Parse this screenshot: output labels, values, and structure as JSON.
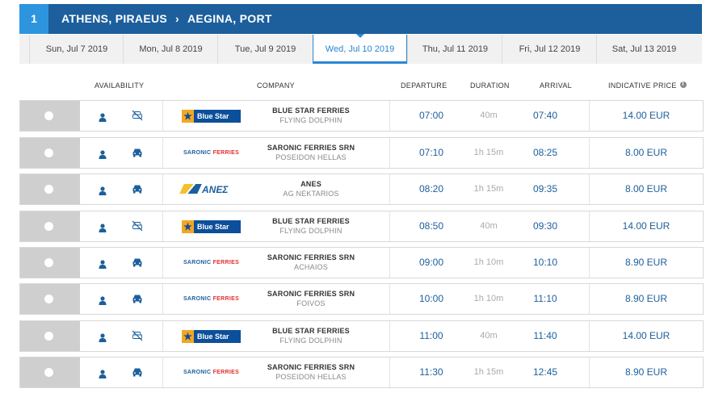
{
  "route": {
    "number": "1",
    "origin": "ATHENS, PIRAEUS",
    "arrow": "›",
    "destination": "AEGINA, PORT"
  },
  "date_tabs": [
    {
      "label": "Sun, Jul 7 2019",
      "active": false
    },
    {
      "label": "Mon, Jul 8 2019",
      "active": false
    },
    {
      "label": "Tue, Jul 9 2019",
      "active": false
    },
    {
      "label": "Wed, Jul 10 2019",
      "active": true
    },
    {
      "label": "Thu, Jul 11 2019",
      "active": false
    },
    {
      "label": "Fri, Jul 12 2019",
      "active": false
    },
    {
      "label": "Sat, Jul 13 2019",
      "active": false
    }
  ],
  "columns": {
    "availability": "AVAILABILITY",
    "company": "COMPANY",
    "departure": "DEPARTURE",
    "duration": "DURATION",
    "arrival": "ARRIVAL",
    "price": "INDICATIVE PRICE"
  },
  "logos": {
    "bluestar": "Blue Star",
    "saronic_a": "SARONIC",
    "saronic_b": "FERRIES",
    "anes": "ΑΝΕΣ"
  },
  "colors": {
    "primary": "#1c5f9c",
    "accent": "#2d95de",
    "active_tab": "#2a86d5"
  },
  "rows": [
    {
      "logo": "bluestar",
      "company": "BLUE STAR FERRIES",
      "ship": "FLYING DOLPHIN",
      "departure": "07:00",
      "duration": "40m",
      "arrival": "07:40",
      "price": "14.00 EUR",
      "vehicles": false
    },
    {
      "logo": "saronic",
      "company": "SARONIC FERRIES SRN",
      "ship": "POSEIDON HELLAS",
      "departure": "07:10",
      "duration": "1h 15m",
      "arrival": "08:25",
      "price": "8.00 EUR",
      "vehicles": true
    },
    {
      "logo": "anes",
      "company": "ANES",
      "ship": "AG NEKTARIOS",
      "departure": "08:20",
      "duration": "1h 15m",
      "arrival": "09:35",
      "price": "8.00 EUR",
      "vehicles": true
    },
    {
      "logo": "bluestar",
      "company": "BLUE STAR FERRIES",
      "ship": "FLYING DOLPHIN",
      "departure": "08:50",
      "duration": "40m",
      "arrival": "09:30",
      "price": "14.00 EUR",
      "vehicles": false
    },
    {
      "logo": "saronic",
      "company": "SARONIC FERRIES SRN",
      "ship": "ACHAIOS",
      "departure": "09:00",
      "duration": "1h 10m",
      "arrival": "10:10",
      "price": "8.90 EUR",
      "vehicles": true
    },
    {
      "logo": "saronic",
      "company": "SARONIC FERRIES SRN",
      "ship": "FOIVOS",
      "departure": "10:00",
      "duration": "1h 10m",
      "arrival": "11:10",
      "price": "8.90 EUR",
      "vehicles": true
    },
    {
      "logo": "bluestar",
      "company": "BLUE STAR FERRIES",
      "ship": "FLYING DOLPHIN",
      "departure": "11:00",
      "duration": "40m",
      "arrival": "11:40",
      "price": "14.00 EUR",
      "vehicles": false
    },
    {
      "logo": "saronic",
      "company": "SARONIC FERRIES SRN",
      "ship": "POSEIDON HELLAS",
      "departure": "11:30",
      "duration": "1h 15m",
      "arrival": "12:45",
      "price": "8.90 EUR",
      "vehicles": true
    }
  ]
}
